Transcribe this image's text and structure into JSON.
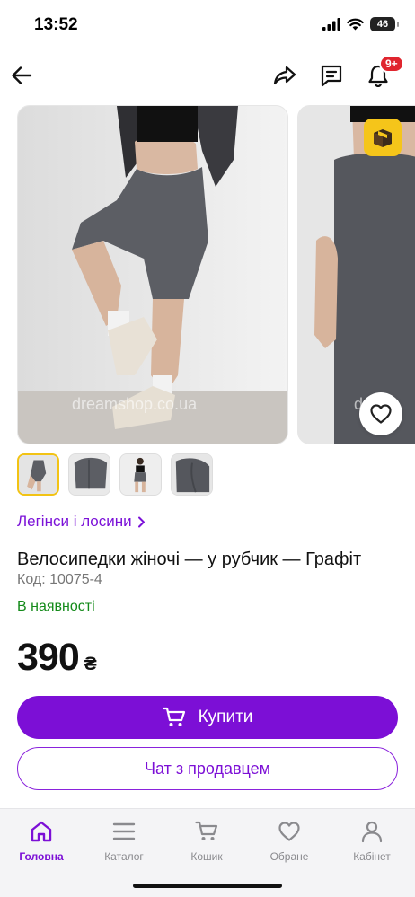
{
  "status_bar": {
    "time": "13:52",
    "battery_level": "46"
  },
  "top_nav": {
    "notifications_badge": "9+"
  },
  "gallery": {
    "watermark": "dreamshop.co.ua",
    "watermark_partial": "dr",
    "photo_count": 2
  },
  "thumbnails": {
    "count": 4,
    "active_index": 0
  },
  "category_link": "Легінси і лосини",
  "product": {
    "title": "Велосипедки жіночі — у рубчик — Графіт",
    "code": "Код: 10075-4",
    "availability": "В наявності",
    "price": "390",
    "currency": "₴"
  },
  "actions": {
    "buy_label": "Купити",
    "chat_label": "Чат з продавцем"
  },
  "tabbar": {
    "items": [
      {
        "label": "Головна",
        "icon": "home-icon",
        "active": true
      },
      {
        "label": "Каталог",
        "icon": "menu-icon",
        "active": false
      },
      {
        "label": "Кошик",
        "icon": "cart-icon",
        "active": false
      },
      {
        "label": "Обране",
        "icon": "heart-icon",
        "active": false
      },
      {
        "label": "Кабінет",
        "icon": "person-icon",
        "active": false
      }
    ]
  },
  "colors": {
    "accent": "#7c0fd6",
    "in_stock": "#138a19",
    "badge": "#e0252e",
    "gift": "#f5c51a"
  }
}
